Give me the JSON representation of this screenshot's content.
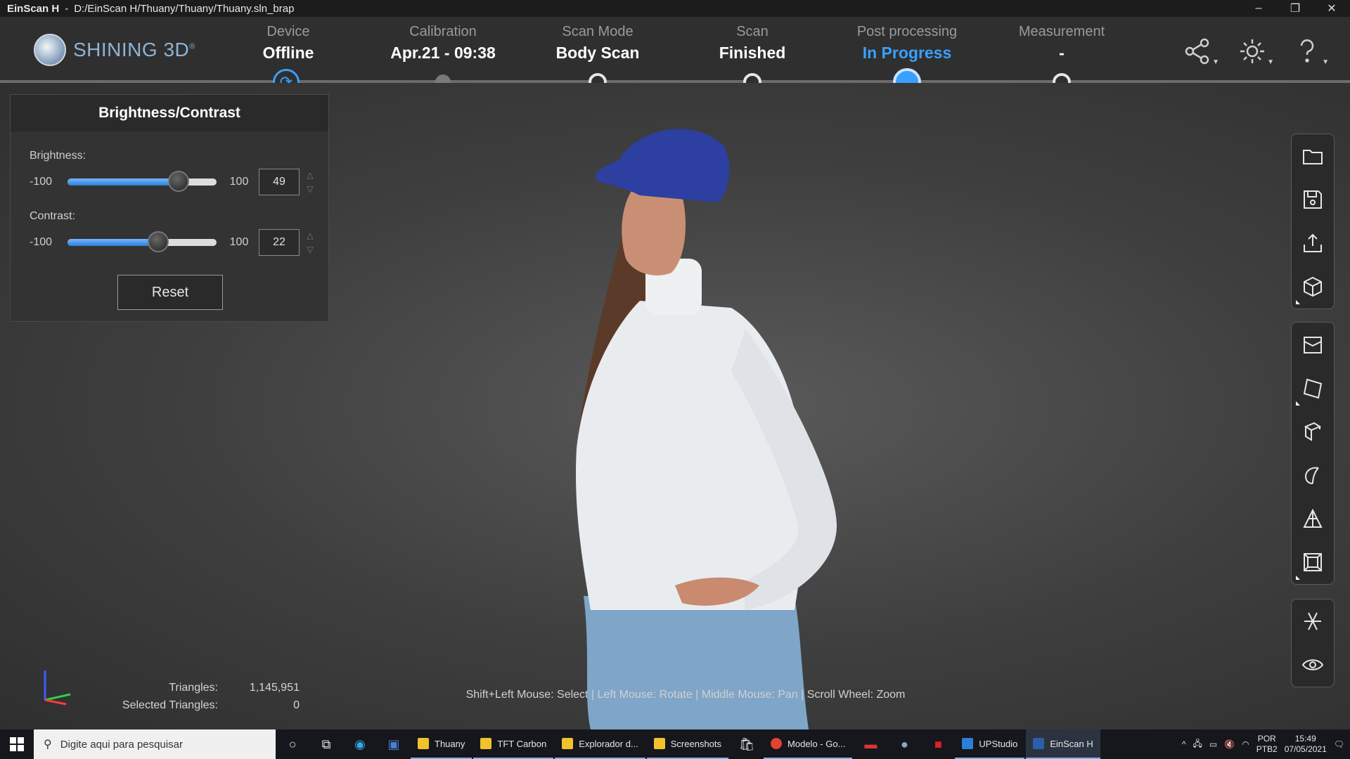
{
  "titlebar": {
    "app": "EinScan H",
    "separator": "-",
    "path": "D:/EinScan H/Thuany/Thuany/Thuany.sln_brap",
    "minimize": "–",
    "restore": "❐",
    "close": "✕"
  },
  "logo": {
    "text": "SHINING 3D",
    "mark": "®"
  },
  "steps": [
    {
      "label": "Device",
      "value": "Offline"
    },
    {
      "label": "Calibration",
      "value": "Apr.21 - 09:38"
    },
    {
      "label": "Scan Mode",
      "value": "Body Scan"
    },
    {
      "label": "Scan",
      "value": "Finished"
    },
    {
      "label": "Post processing",
      "value": "In Progress"
    },
    {
      "label": "Measurement",
      "value": "-"
    }
  ],
  "colors": {
    "accent": "#3aa0ff",
    "background": "#3a3a3a",
    "panel": "#333333"
  },
  "header_icons": [
    "share-icon",
    "settings-icon",
    "help-icon"
  ],
  "panel": {
    "title": "Brightness/Contrast",
    "brightness": {
      "label": "Brightness:",
      "min": "-100",
      "max": "100",
      "value": "49",
      "fraction": 0.745
    },
    "contrast": {
      "label": "Contrast:",
      "min": "-100",
      "max": "100",
      "value": "22",
      "fraction": 0.61
    },
    "reset": "Reset",
    "spin_up": "△",
    "spin_down": "▽"
  },
  "right_toolbar": {
    "group1": [
      "open-folder-icon",
      "save-icon",
      "export-icon",
      "mesh-cube-icon"
    ],
    "group2": [
      "crop-box-icon",
      "plane-cut-icon",
      "box-select-icon",
      "lasso-icon",
      "triangle-icon",
      "save-model-icon"
    ],
    "group3": [
      "symmetry-icon",
      "eye-icon"
    ]
  },
  "stats": {
    "triangles_label": "Triangles:",
    "triangles_value": "1,145,951",
    "selected_label": "Selected Triangles:",
    "selected_value": "0"
  },
  "hint": "Shift+Left Mouse: Select | Left Mouse: Rotate | Middle Mouse: Pan | Scroll Wheel: Zoom",
  "taskbar": {
    "search_placeholder": "Digite aqui para pesquisar",
    "apps": [
      {
        "label": "Thuany",
        "color": "#f2c12e"
      },
      {
        "label": "TFT Carbon",
        "color": "#f2c12e"
      },
      {
        "label": "Explorador d...",
        "color": "#f2c12e"
      },
      {
        "label": "Screenshots",
        "color": "#f2c12e"
      },
      {
        "label": "Modelo - Go...",
        "color": "#e34133"
      },
      {
        "label": "UPStudio",
        "color": "#2b7fd9"
      },
      {
        "label": "EinScan H",
        "color": "#2b5fa8"
      }
    ],
    "lang_top": "POR",
    "lang_bottom": "PTB2",
    "time": "15:49",
    "date": "07/05/2021"
  }
}
